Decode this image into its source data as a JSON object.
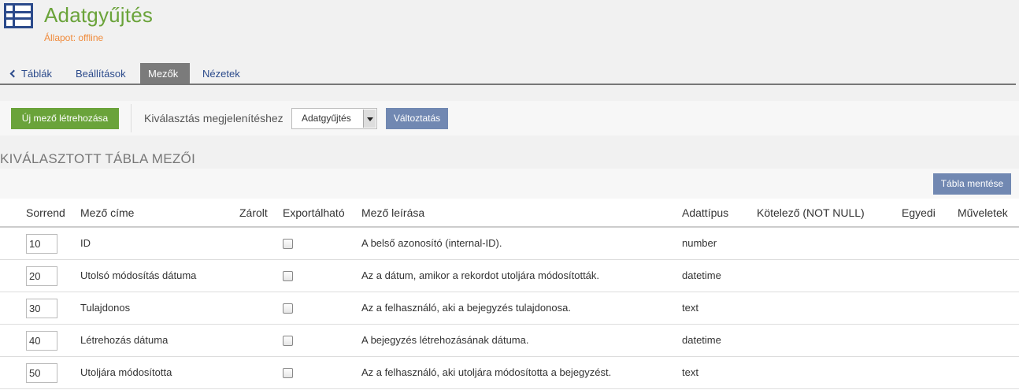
{
  "header": {
    "icon": "table-icon",
    "title": "Adatgyűjtés",
    "status": "Állapot: offline",
    "colors": {
      "title": "#6aa33a",
      "status": "#f08a3a",
      "accent": "#2b4a8b"
    }
  },
  "tabs": [
    {
      "label": "Táblák",
      "icon": "chevron-left-icon",
      "active": false
    },
    {
      "label": "Beállítások",
      "active": false
    },
    {
      "label": "Mezők",
      "active": true
    },
    {
      "label": "Nézetek",
      "active": false
    }
  ],
  "toolbar": {
    "new_field_label": "Új mező létrehozása",
    "select_label": "Kiválasztás megjelenítéshez",
    "select_value": "Adatgyűjtés",
    "change_label": "Változtatás"
  },
  "section": {
    "title": "KIVÁLASZTOTT TÁBLA MEZŐI",
    "save_label": "Tábla mentése"
  },
  "table": {
    "columns": [
      "Sorrend",
      "Mező címe",
      "Zárolt",
      "Exportálható",
      "Mező leírása",
      "Adattípus",
      "Kötelező (NOT NULL)",
      "Egyedi",
      "Műveletek"
    ],
    "rows": [
      {
        "order": "10",
        "title": "ID",
        "description": "A belső azonosító (internal-ID).",
        "type": "number",
        "exportable": false
      },
      {
        "order": "20",
        "title": "Utolsó módosítás dátuma",
        "description": "Az a dátum, amikor a rekordot utoljára módosították.",
        "type": "datetime",
        "exportable": false
      },
      {
        "order": "30",
        "title": "Tulajdonos",
        "description": "Az a felhasználó, aki a bejegyzés tulajdonosa.",
        "type": "text",
        "exportable": false
      },
      {
        "order": "40",
        "title": "Létrehozás dátuma",
        "description": "A bejegyzés létrehozásának dátuma.",
        "type": "datetime",
        "exportable": false
      },
      {
        "order": "50",
        "title": "Utoljára módosította",
        "description": "Az a felhasználó, aki utoljára módosította a bejegyzést.",
        "type": "text",
        "exportable": false
      }
    ]
  }
}
